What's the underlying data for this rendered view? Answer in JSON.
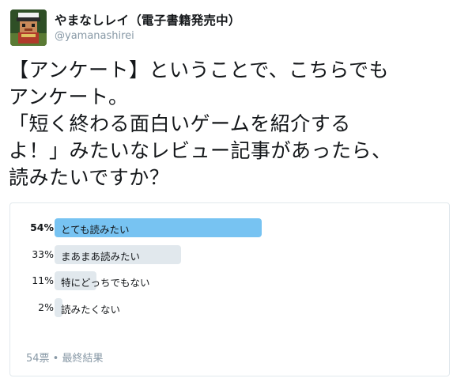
{
  "author": {
    "name": "やまなしレイ（電子書籍発売中）",
    "handle": "@yamanashirei"
  },
  "tweet": {
    "text": "【アンケート】ということで、こちらでも\nアンケート。\n「短く終わる面白いゲームを紹介する\nよ！」みたいなレビュー記事があったら、\n読みたいですか？"
  },
  "poll": {
    "options": [
      {
        "percent_label": "54%",
        "percent": 54,
        "label": "とても読みたい",
        "winner": true
      },
      {
        "percent_label": "33%",
        "percent": 33,
        "label": "まあまあ読みたい",
        "winner": false
      },
      {
        "percent_label": "11%",
        "percent": 11,
        "label": "特にどっちでもない",
        "winner": false
      },
      {
        "percent_label": "2%",
        "percent": 2,
        "label": "読みたくない",
        "winner": false
      }
    ],
    "footer": "54票 • 最終結果"
  },
  "colors": {
    "winner_bar": "#77c3f2",
    "bar": "#e1e8ed",
    "muted_text": "#8899a6"
  }
}
